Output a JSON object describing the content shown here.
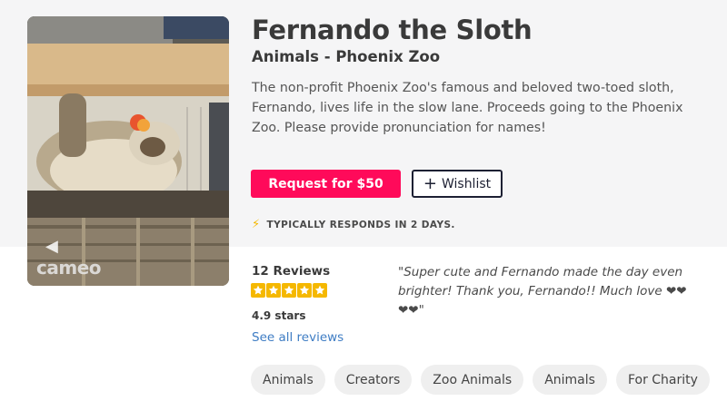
{
  "profile": {
    "name": "Fernando the Sloth",
    "category_line": "Animals - Phoenix Zoo",
    "description": "The non-profit Phoenix Zoo's famous and beloved two-toed sloth, Fernando, lives life in the slow lane. Proceeds going to the Phoenix Zoo. Please provide pronunciation for names!"
  },
  "video": {
    "watermark": "cameo",
    "icon": "speaker-icon"
  },
  "actions": {
    "request_label": "Request for $50",
    "wishlist_label": "Wishlist",
    "wishlist_icon": "plus-icon"
  },
  "response_time": {
    "icon": "lightning-icon",
    "text": "TYPICALLY RESPONDS IN 2 DAYS."
  },
  "reviews": {
    "count_label": "12 Reviews",
    "stars": 5,
    "rating_label": "4.9 stars",
    "see_all_label": "See all reviews",
    "featured_quote": "\"Super cute and Fernando made the day even brighter! Thank you, Fernando!! Much love ❤❤ ❤❤\""
  },
  "tags": [
    "Animals",
    "Creators",
    "Zoo Animals",
    "Animals",
    "For Charity"
  ],
  "colors": {
    "primary": "#ff0a5a",
    "star": "#f5b800",
    "link": "#3f7dc4",
    "band_bg": "#f5f5f6"
  }
}
